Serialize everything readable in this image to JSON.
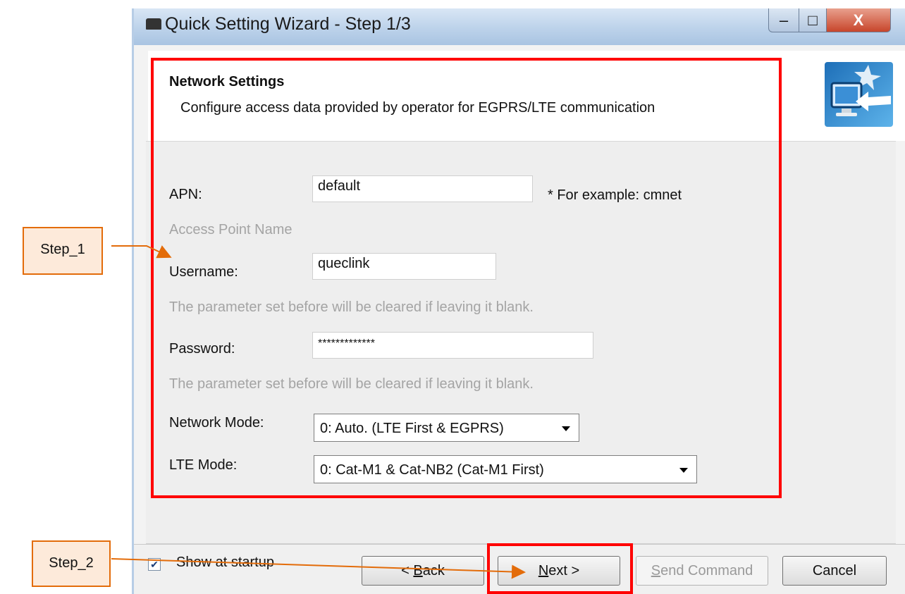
{
  "window": {
    "title": "Quick Setting Wizard - Step 1/3",
    "controls": {
      "minimize": "–",
      "maximize": "□",
      "close": "X"
    }
  },
  "header": {
    "title": "Network Settings",
    "description": "Configure access data provided by operator for EGPRS/LTE communication",
    "icon": "wizard-monitor-icon"
  },
  "form": {
    "apn": {
      "label": "APN:",
      "value": "default",
      "note": "*  For example: cmnet",
      "hint": "Access Point Name"
    },
    "username": {
      "label": "Username:",
      "value": "queclink",
      "hint": "The parameter set before will be cleared if leaving it blank."
    },
    "password": {
      "label": "Password:",
      "value": "*************",
      "hint": "The parameter set before will be cleared if leaving it blank."
    },
    "network_mode": {
      "label": "Network Mode:",
      "selected": "0: Auto. (LTE First & EGPRS)"
    },
    "lte_mode": {
      "label": "LTE Mode:",
      "selected": "0: Cat-M1 & Cat-NB2 (Cat-M1 First)"
    }
  },
  "footer": {
    "show_at_startup": {
      "label": "Show at startup",
      "checked": true
    },
    "buttons": {
      "back_prefix": "< ",
      "back_key": "B",
      "back_rest": "ack",
      "next_key": "N",
      "next_rest": "ext >",
      "send_key": "S",
      "send_rest": "end Command",
      "cancel": "Cancel"
    }
  },
  "annotations": {
    "step1": "Step_1",
    "step2": "Step_2",
    "highlight_color": "#ff0000",
    "callout_color": "#e36c0a"
  }
}
